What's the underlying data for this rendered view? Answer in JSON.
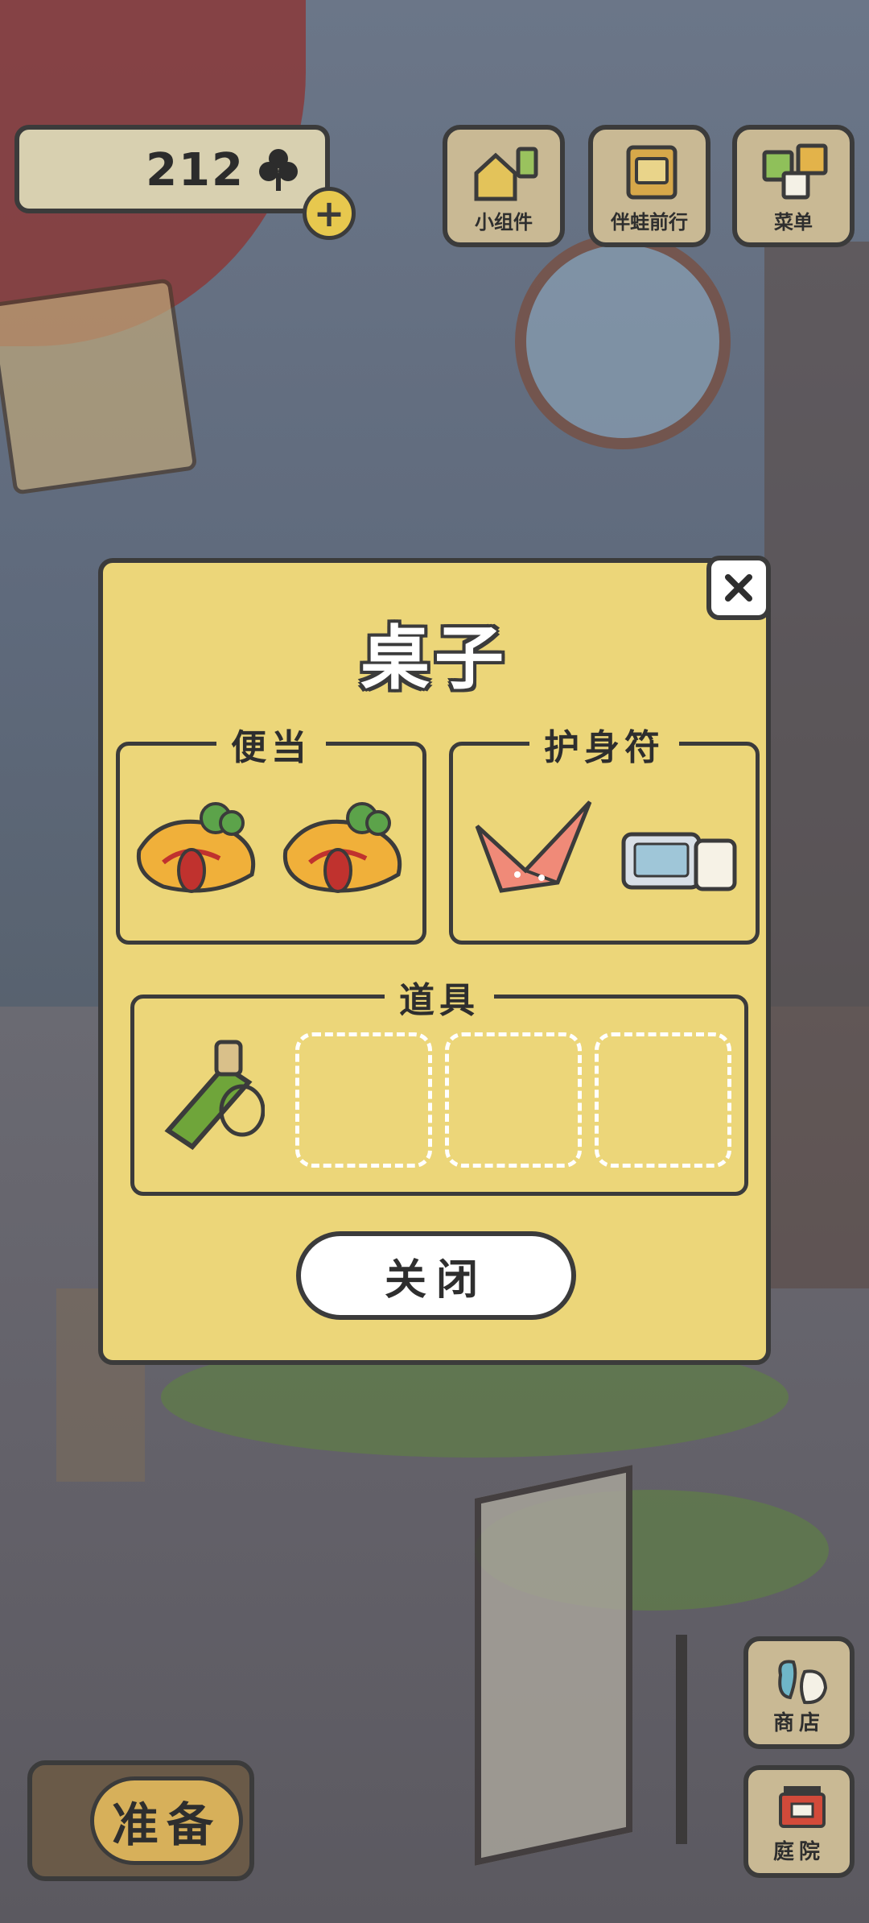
{
  "hud": {
    "clover_count": "212",
    "add_label": "+",
    "buttons": [
      {
        "label": "小组件",
        "icon": "widget-icon"
      },
      {
        "label": "伴蛙前行",
        "icon": "album-icon"
      },
      {
        "label": "菜单",
        "icon": "menu-icon"
      }
    ]
  },
  "modal": {
    "title": "桌子",
    "close_x": "✕",
    "sections": {
      "bento": {
        "label": "便当",
        "items": [
          "omelette-rice-bento",
          "omelette-rice-bento"
        ]
      },
      "charm": {
        "label": "护身符",
        "items": [
          "paper-crane-charm",
          "photo-ticket-charm"
        ]
      },
      "tools": {
        "label": "道具",
        "items": [
          "bamboo-canteen"
        ],
        "empty_slots": 3
      }
    },
    "close_button": "关闭"
  },
  "bottom": {
    "prepare_label": "准备",
    "shop_label": "商店",
    "garden_label": "庭院"
  },
  "colors": {
    "panel": "#ecd679",
    "outline": "#3b3b3b",
    "hud_button": "#c9b994"
  }
}
